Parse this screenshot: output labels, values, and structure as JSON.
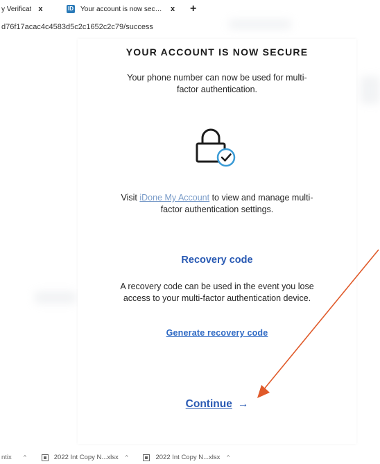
{
  "browser": {
    "tabs": [
      {
        "title": "y Verificat",
        "close": "x",
        "favicon": ""
      },
      {
        "title": "Your account is now secure - It",
        "close": "x",
        "favicon": "ID"
      }
    ],
    "new_tab": "+",
    "url": "d76f17acac4c4583d5c2c1652c2c79/success"
  },
  "card": {
    "heading": "YOUR ACCOUNT IS NOW SECURE",
    "intro": "Your phone number can now be used for multi-factor authentication.",
    "icon": "lock-check-icon",
    "visit_prefix": "Visit ",
    "visit_link": "iDone My Account",
    "visit_suffix": " to view and manage multi-factor authentication settings.",
    "recovery_title": "Recovery code",
    "recovery_text": "A recovery code can be used in the event you lose access to your multi-factor authentication device.",
    "generate_link": "Generate recovery code",
    "continue_label": "Continue",
    "continue_arrow": "→"
  },
  "downloads": {
    "edge_label": "ntix",
    "items": [
      {
        "name": "2022 Int Copy N...xlsx"
      },
      {
        "name": "2022 Int Copy N...xlsx"
      }
    ],
    "caret": "^"
  },
  "colors": {
    "accent": "#2859b3",
    "link": "#2f6ac4",
    "annotation": "#e05a2a",
    "lock_check": "#3a9bd6"
  }
}
